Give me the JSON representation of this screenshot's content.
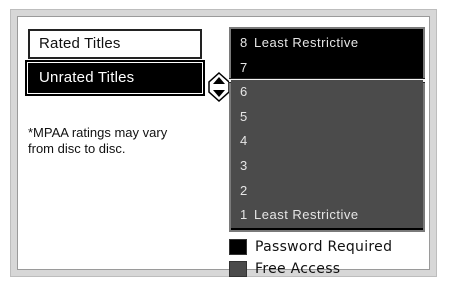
{
  "menu": {
    "rated_label": "Rated Titles",
    "unrated_label": "Unrated Titles"
  },
  "note": "*MPAA ratings may vary from disc to disc.",
  "levels": [
    {
      "num": "8",
      "label": "Least Restrictive",
      "access": "password"
    },
    {
      "num": "7",
      "label": "",
      "access": "password",
      "selected": true
    },
    {
      "num": "6",
      "label": "",
      "access": "free"
    },
    {
      "num": "5",
      "label": "",
      "access": "free"
    },
    {
      "num": "4",
      "label": "",
      "access": "free"
    },
    {
      "num": "3",
      "label": "",
      "access": "free"
    },
    {
      "num": "2",
      "label": "",
      "access": "free"
    },
    {
      "num": "1",
      "label": "Least Restrictive",
      "access": "free"
    }
  ],
  "legend": {
    "password_label": "Password Required",
    "free_label": "Free Access"
  },
  "colors": {
    "password": "#000000",
    "free": "#4b4b4b"
  },
  "icons": {
    "selector": "up-down-arrows-icon"
  }
}
